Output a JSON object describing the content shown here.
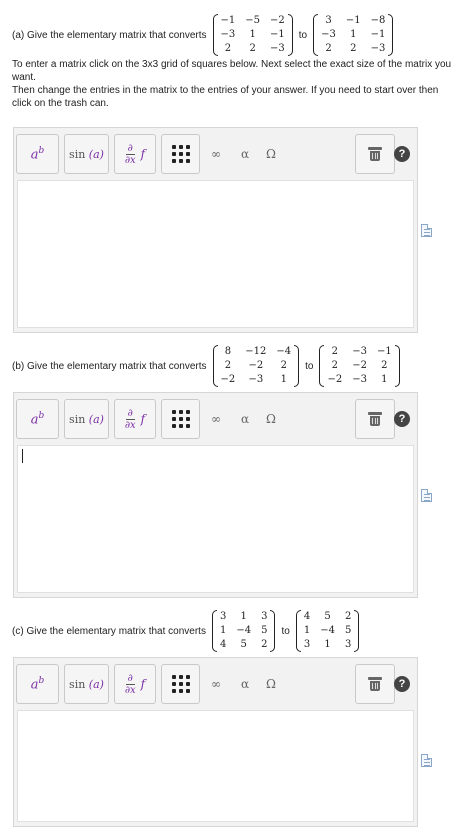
{
  "questions": [
    {
      "id": "a",
      "text": "(a) Give the elementary matrix that converts",
      "from": [
        [
          "−1",
          "−5",
          "−2"
        ],
        [
          "−3",
          "1",
          "−1"
        ],
        [
          "2",
          "2",
          "−3"
        ]
      ],
      "to_label": "to",
      "to": [
        [
          "3",
          "−1",
          "−8"
        ],
        [
          "−3",
          "1",
          "−1"
        ],
        [
          "2",
          "2",
          "−3"
        ]
      ]
    },
    {
      "id": "b",
      "text": "(b) Give the elementary matrix that converts",
      "from": [
        [
          "8",
          "−12",
          "−4"
        ],
        [
          "2",
          "−2",
          "2"
        ],
        [
          "−2",
          "−3",
          "1"
        ]
      ],
      "to_label": "to",
      "to": [
        [
          "2",
          "−3",
          "−1"
        ],
        [
          "2",
          "−2",
          "2"
        ],
        [
          "−2",
          "−3",
          "1"
        ]
      ]
    },
    {
      "id": "c",
      "text": "(c) Give the elementary matrix that converts",
      "from": [
        [
          "3",
          "1",
          "3"
        ],
        [
          "1",
          "−4",
          "5"
        ],
        [
          "4",
          "5",
          "2"
        ]
      ],
      "to_label": "to",
      "to": [
        [
          "4",
          "5",
          "2"
        ],
        [
          "1",
          "−4",
          "5"
        ],
        [
          "3",
          "1",
          "3"
        ]
      ]
    }
  ],
  "instructions": {
    "line1": "To enter a matrix click on the 3x3 grid of squares below. Next select the exact size of the matrix you want.",
    "line2": "Then change the entries in the matrix to the entries of your answer. If you need to start over then click on the trash can."
  },
  "toolbar": {
    "ab_base": "a",
    "ab_sup": "b",
    "sin_label": "sin",
    "sin_arg": "(a)",
    "deriv_num": "∂",
    "deriv_den": "∂x",
    "deriv_f": "f",
    "infinity": "∞",
    "alpha": "α",
    "omega": "Ω",
    "help": "?"
  },
  "icons": {
    "superscript": "superscript-icon",
    "sine": "sine-function-icon",
    "derivative": "partial-derivative-icon",
    "matrix": "matrix-grid-icon",
    "infinity": "infinity-icon",
    "alpha": "greek-letters-icon",
    "omega": "special-symbols-icon",
    "trash": "trash-icon",
    "help": "help-icon",
    "document": "document-icon"
  },
  "colors": {
    "accent": "#7b2fa6",
    "toolbar_bg": "#f2f2f2",
    "border": "#d6d6d6"
  }
}
